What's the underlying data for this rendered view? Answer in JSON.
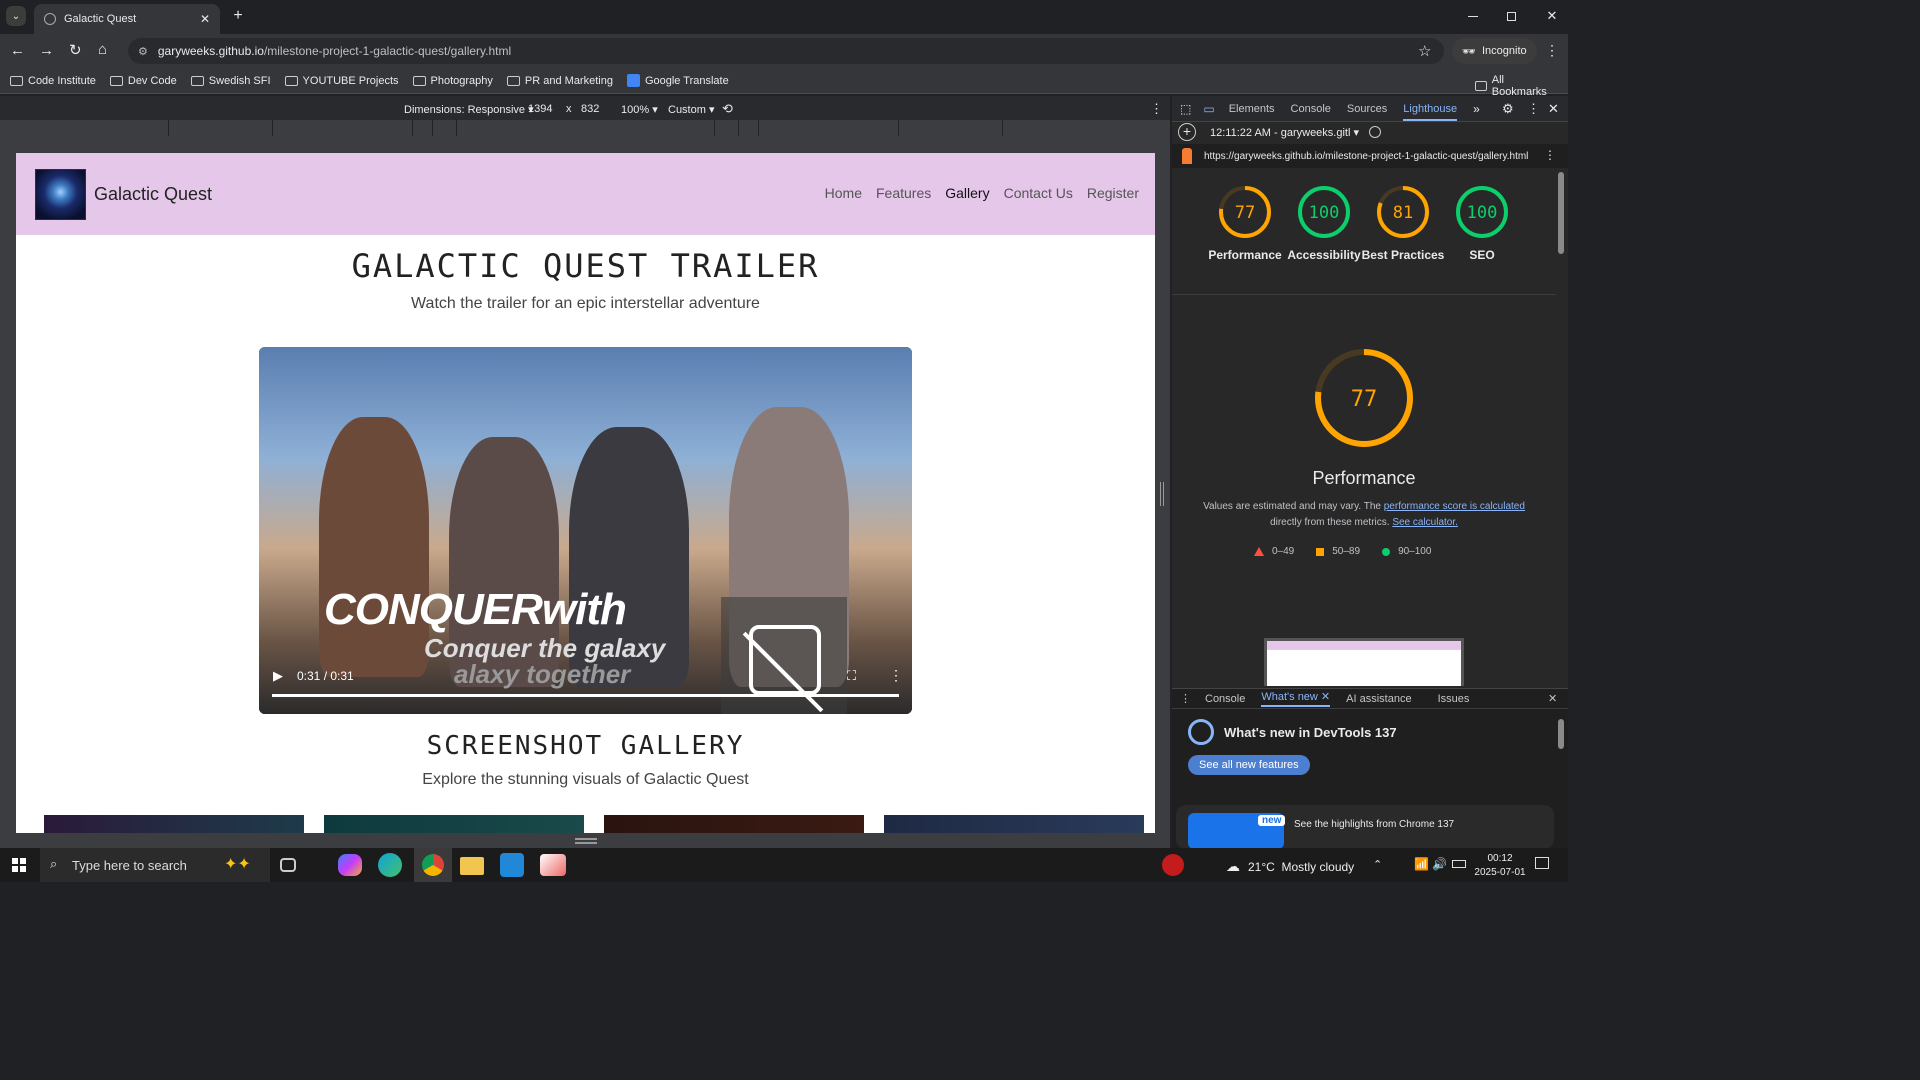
{
  "browser": {
    "tab_title": "Galactic Quest",
    "url_host": "garyweeks.github.io",
    "url_path": "/milestone-project-1-galactic-quest/gallery.html",
    "profile": "Incognito",
    "bookmarks": [
      "Code Institute",
      "Dev Code",
      "Swedish SFI",
      "YOUTUBE Projects",
      "Photography",
      "PR and Marketing",
      "Google Translate"
    ],
    "all_bookmarks": "All Bookmarks"
  },
  "device_toolbar": {
    "dimensions": "Dimensions: Responsive",
    "width": "1394",
    "times": "x",
    "height": "832",
    "zoom": "100%",
    "throttle": "Custom"
  },
  "site": {
    "brand": "Galactic Quest",
    "nav": [
      "Home",
      "Features",
      "Gallery",
      "Contact Us",
      "Register"
    ],
    "trailer_title": "GALACTIC QUEST TRAILER",
    "trailer_subtitle": "Watch the trailer for an epic interstellar adventure",
    "video_time": "0:31 / 0:31",
    "video_progress": 1.0,
    "video_overlay_big": "CONQUERwith",
    "video_overlay_sub": "Conquer the galaxy",
    "video_overlay_sub2": "alaxy together",
    "gallery_title": "SCREENSHOT GALLERY",
    "gallery_subtitle": "Explore the stunning visuals of Galactic Quest"
  },
  "devtools": {
    "tabs": [
      "Elements",
      "Console",
      "Sources",
      "Lighthouse"
    ],
    "active_tab": "Lighthouse",
    "report_time": "12:11:22 AM - garyweeks.gitl",
    "report_url": "https://garyweeks.github.io/milestone-project-1-galactic-quest/gallery.html",
    "scores": [
      {
        "value": "77",
        "label": "Performance",
        "color": "#ffa400",
        "fraction": 0.77
      },
      {
        "value": "100",
        "label": "Accessibility",
        "color": "#0cce6b",
        "fraction": 1.0
      },
      {
        "value": "81",
        "label": "Best Practices",
        "color": "#ffa400",
        "fraction": 0.81
      },
      {
        "value": "100",
        "label": "SEO",
        "color": "#0cce6b",
        "fraction": 1.0
      }
    ],
    "big_score": "77",
    "big_label": "Performance",
    "note_prefix": "Values are estimated and may vary. The ",
    "note_link1": "performance score is calculated",
    "note_mid": "directly from these metrics.",
    "note_link2": "See calculator.",
    "legend": [
      "0–49",
      "50–89",
      "90–100"
    ],
    "drawer_tabs": [
      "Console",
      "What's new",
      "AI assistance",
      "Issues"
    ],
    "whats_new_title": "What's new in DevTools 137",
    "see_all_button": "See all new features",
    "new_badge": "new",
    "highlights": "See the highlights from Chrome 137"
  },
  "taskbar": {
    "search_placeholder": "Type here to search",
    "weather": "21°C  Mostly cloudy",
    "time": "00:12",
    "date": "2025-07-01"
  }
}
